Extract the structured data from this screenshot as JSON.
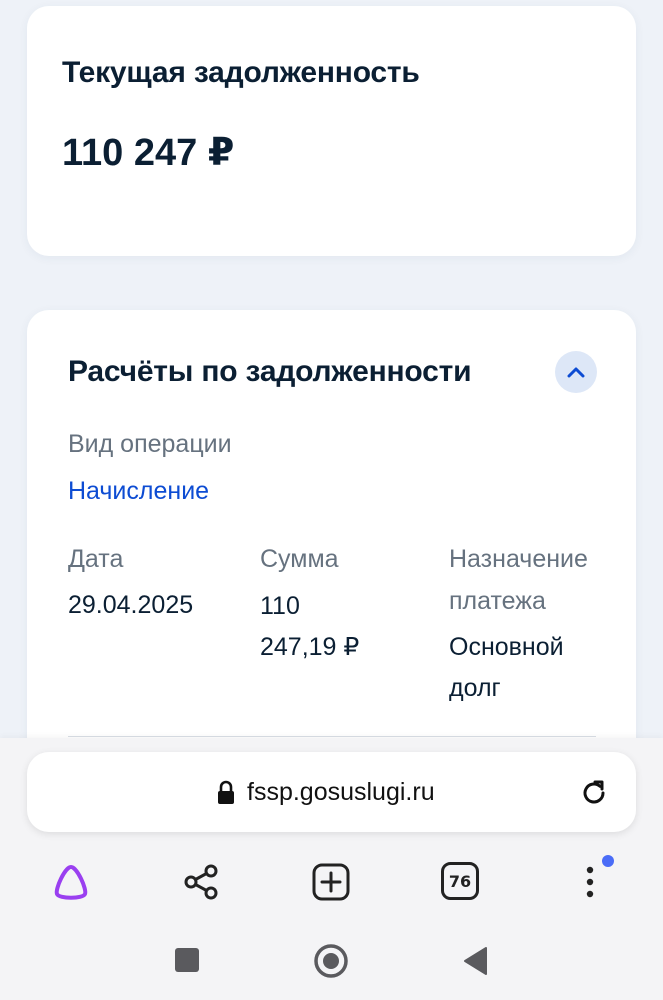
{
  "debt_card": {
    "title": "Текущая задолженность",
    "amount": "110 247 ₽"
  },
  "calc_card": {
    "title": "Расчёты по задолженности",
    "collapse_icon": "chevron-up-icon",
    "operation_label": "Вид операции",
    "operation_value": "Начисление",
    "columns": {
      "date_label": "Дата",
      "sum_label": "Сумма",
      "purpose_label_line1": "Назначение",
      "purpose_label_line2": "платежа"
    },
    "row": {
      "date": "29.04.2025",
      "sum_line1": "110",
      "sum_line2": "247,19 ₽",
      "purpose_line1": "Основной",
      "purpose_line2": "долг"
    }
  },
  "browser": {
    "url": "fssp.gosuslugi.ru",
    "tabs_count": "76",
    "icons": [
      "alice-icon",
      "share-icon",
      "new-tab-icon",
      "tabs-icon",
      "menu-icon",
      "reload-icon",
      "lock-icon"
    ],
    "accent_color": "#4a6cf7"
  },
  "system_nav": {
    "icons": [
      "recents-square-icon",
      "home-circle-icon",
      "back-triangle-icon"
    ]
  },
  "colors": {
    "text_primary": "#0b1f33",
    "text_secondary": "#66727f",
    "link": "#0d4cd3",
    "background": "#eef2f8"
  }
}
